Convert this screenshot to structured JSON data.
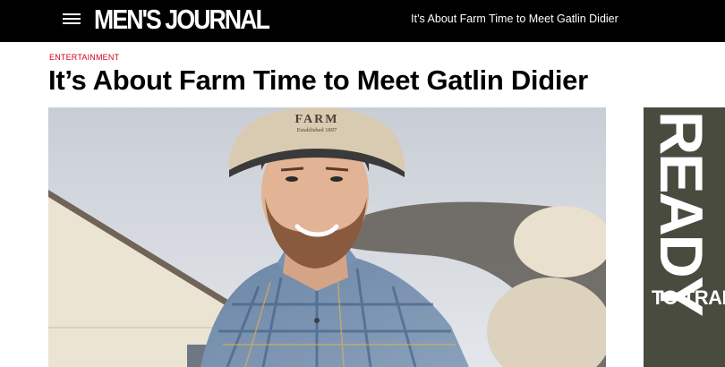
{
  "header": {
    "logo_text": "MEN'S JOURNAL",
    "article_title": "It’s About Farm Time to Meet Gatlin Didier",
    "menu_icon": "hamburger-menu-icon"
  },
  "article": {
    "category": "ENTERTAINMENT",
    "headline": "It’s About Farm Time to Meet Gatlin Didier",
    "hero_cap_text": "FARM",
    "hero_cap_subtext": "Established 1897"
  },
  "ad": {
    "big_text": "READY",
    "small_text": "TO TRAIN"
  },
  "colors": {
    "topbar": "#000000",
    "category": "#d0021b",
    "ad_background": "#4a4b3f"
  }
}
